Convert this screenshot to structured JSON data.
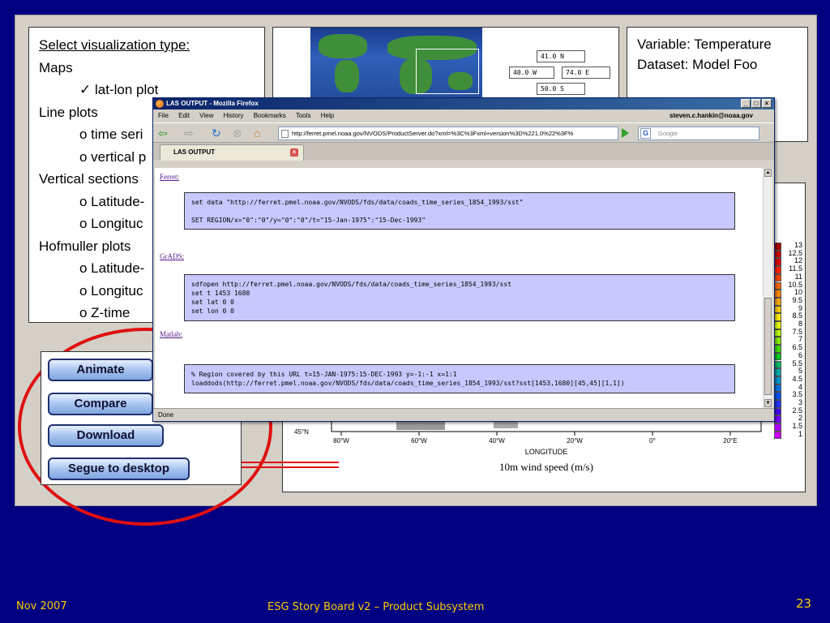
{
  "selection": {
    "title": "Select visualization type:",
    "maps": "Maps",
    "latlon": "✓ lat-lon plot",
    "line_plots": "Line plots",
    "time_series": "o time seri",
    "vertical_p": "o vertical p",
    "vertical_sections": "Vertical sections",
    "vs_lat": "o Latitude-",
    "vs_lon": "o Longituc",
    "hofmuller": "Hofmuller plots",
    "h_lat": "o Latitude-",
    "h_lon": "o Longituc",
    "h_z": "o Z-time"
  },
  "region": {
    "north": "41.0 N",
    "west": "40.0 W",
    "east": "74.0 E",
    "south": "50.0 S"
  },
  "variable": {
    "line1": "Variable: Temperature",
    "line2": "Dataset: Model Foo"
  },
  "buttons": {
    "animate": "Animate",
    "compare": "Compare",
    "download": "Download",
    "segue": "Segue to desktop"
  },
  "plot": {
    "ylabel_45": "45°N",
    "xticks": [
      "80°W",
      "60°W",
      "40°W",
      "20°W",
      "0°",
      "20°E"
    ],
    "xlabel": "LONGITUDE",
    "caption": "10m wind speed (m/s)",
    "legend_labels": [
      "13",
      "12.5",
      "12",
      "11.5",
      "11",
      "10.5",
      "10",
      "9.5",
      "9",
      "8.5",
      "8",
      "7.5",
      "7",
      "6.5",
      "6",
      "5.5",
      "5",
      "4.5",
      "4",
      "3.5",
      "3",
      "2.5",
      "2",
      "1.5",
      "1"
    ],
    "legend_colors": [
      "#aa0000",
      "#cc0000",
      "#e00000",
      "#ff2200",
      "#ff4400",
      "#ff6600",
      "#ff8800",
      "#ffaa00",
      "#ffcc00",
      "#ffee00",
      "#e8ff00",
      "#c0ff00",
      "#88ee00",
      "#44dd00",
      "#00cc20",
      "#00bb66",
      "#00aaaa",
      "#0099cc",
      "#0077ee",
      "#0055ff",
      "#2233ff",
      "#4400ff",
      "#7700ff",
      "#aa00ff",
      "#cc00ff"
    ]
  },
  "browser": {
    "title": "LAS OUTPUT - Mozilla Firefox",
    "menu": [
      "File",
      "Edit",
      "View",
      "History",
      "Bookmarks",
      "Tools",
      "Help"
    ],
    "account": "steven.c.hankin@noaa.gov",
    "url": "http://ferret.pmel.noaa.gov/NVODS/ProductServer.do?xml=%3C%3Fxml+version%3D%221.0%22%3F%",
    "search_placeholder": "Google",
    "tab_label": "LAS OUTPUT",
    "status": "Done",
    "ferret_label": "Ferret",
    "ferret_code": "set data \"http://ferret.pmel.noaa.gov/NVODS/fds/data/coads_time_series_1854_1993/sst\"\n\nSET REGION/x=\"0\":\"0\"/y=\"0\":\"0\"/t=\"15-Jan-1975\":\"15-Dec-1993\"",
    "grads_label": "GrADS",
    "grads_code": "sdfopen http://ferret.pmel.noaa.gov/NVODS/fds/data/coads_time_series_1854_1993/sst\nset t 1453 1680\nset lat 0 0\nset lon 0 0",
    "matlab_label": "Matlab",
    "matlab_code": "% Region covered by this URL t=15-JAN-1975:15-DEC-1993 y=-1:-1 x=1:1\nloaddods(http://ferret.pmel.noaa.gov/NVODS/fds/data/coads_time_series_1854_1993/sst?sst[1453,1680][45,45][1,1])"
  },
  "footer": {
    "date": "Nov 2007",
    "title": "ESG Story Board v2 – Product Subsystem",
    "page": "23"
  },
  "colors": {
    "background": "#000080",
    "panel": "#d4d0c8",
    "annotation": "#e01010",
    "footer_text": "#ffcc00",
    "code_bg": "#c8c8ff"
  }
}
